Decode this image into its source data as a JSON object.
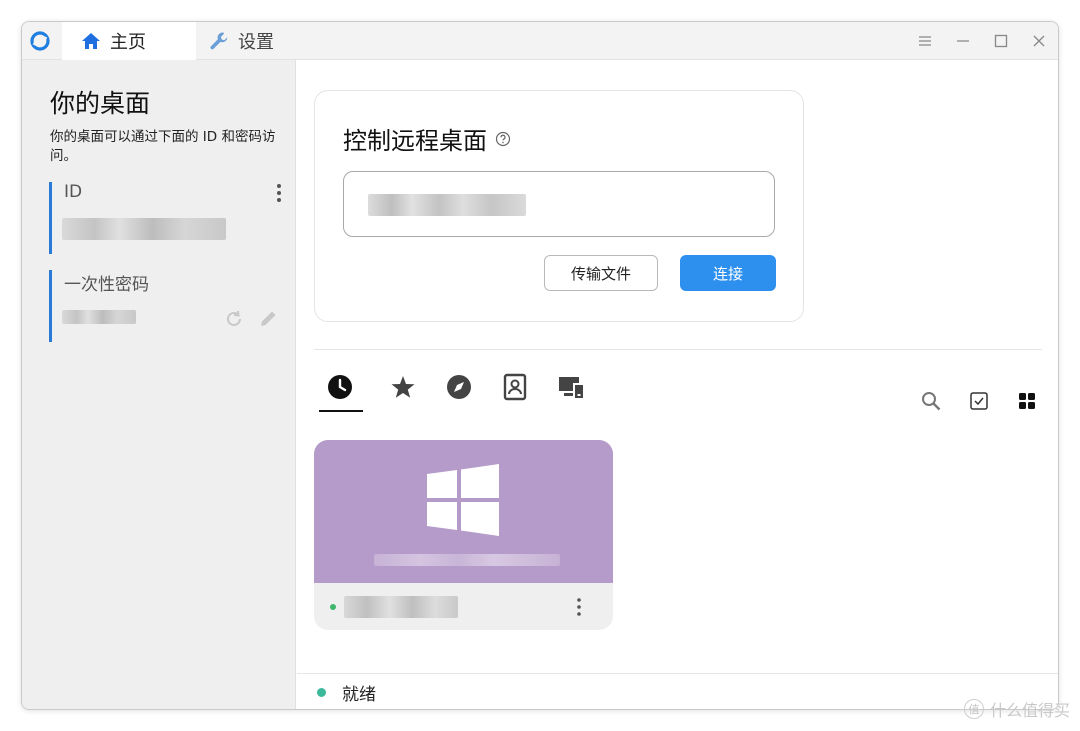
{
  "titlebar": {
    "tabs": [
      {
        "label": "主页",
        "icon": "home-icon",
        "active": true
      },
      {
        "label": "设置",
        "icon": "wrench-icon",
        "active": false
      }
    ],
    "controls": [
      "menu-icon",
      "minimize-icon",
      "maximize-icon",
      "close-icon"
    ]
  },
  "sidebar": {
    "title": "你的桌面",
    "description": "你的桌面可以通过下面的 ID 和密码访问。",
    "id_label": "ID",
    "password_label": "一次性密码"
  },
  "connect": {
    "title": "控制远程桌面",
    "transfer_label": "传输文件",
    "connect_label": "连接"
  },
  "peers": {
    "tabs": [
      "recent-icon",
      "favorites-icon",
      "discovered-icon",
      "address-book-icon",
      "group-icon"
    ],
    "active_tab": "recent-icon",
    "os": "windows-logo-icon",
    "card_color": "#b59bc9",
    "online_color": "#3fb66b"
  },
  "status": {
    "text": "就绪",
    "dot_color": "#3cb89a"
  },
  "watermark": {
    "text": "什么值得买",
    "badge": "值"
  },
  "accent": "#2e90ee"
}
